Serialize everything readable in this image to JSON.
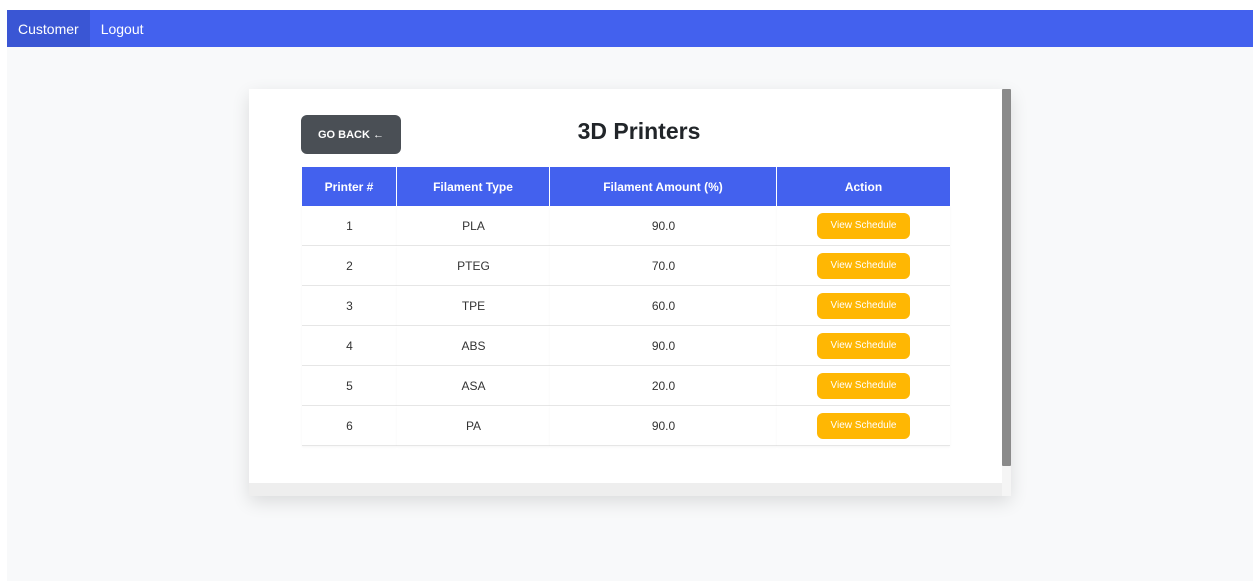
{
  "nav": {
    "items": [
      {
        "label": "Customer"
      },
      {
        "label": "Logout"
      }
    ]
  },
  "page": {
    "title": "3D Printers",
    "back_label": "GO BACK ←"
  },
  "table": {
    "headers": [
      "Printer #",
      "Filament Type",
      "Filament Amount (%)",
      "Action"
    ],
    "rows": [
      {
        "printer": "1",
        "filament_type": "PLA",
        "amount": "90.0",
        "action": "View Schedule"
      },
      {
        "printer": "2",
        "filament_type": "PTEG",
        "amount": "70.0",
        "action": "View Schedule"
      },
      {
        "printer": "3",
        "filament_type": "TPE",
        "amount": "60.0",
        "action": "View Schedule"
      },
      {
        "printer": "4",
        "filament_type": "ABS",
        "amount": "90.0",
        "action": "View Schedule"
      },
      {
        "printer": "5",
        "filament_type": "ASA",
        "amount": "20.0",
        "action": "View Schedule"
      },
      {
        "printer": "6",
        "filament_type": "PA",
        "amount": "90.0",
        "action": "View Schedule"
      }
    ]
  },
  "colors": {
    "primary": "#4361ee",
    "accent": "#ffb703",
    "dark_button": "#4a4f55"
  }
}
